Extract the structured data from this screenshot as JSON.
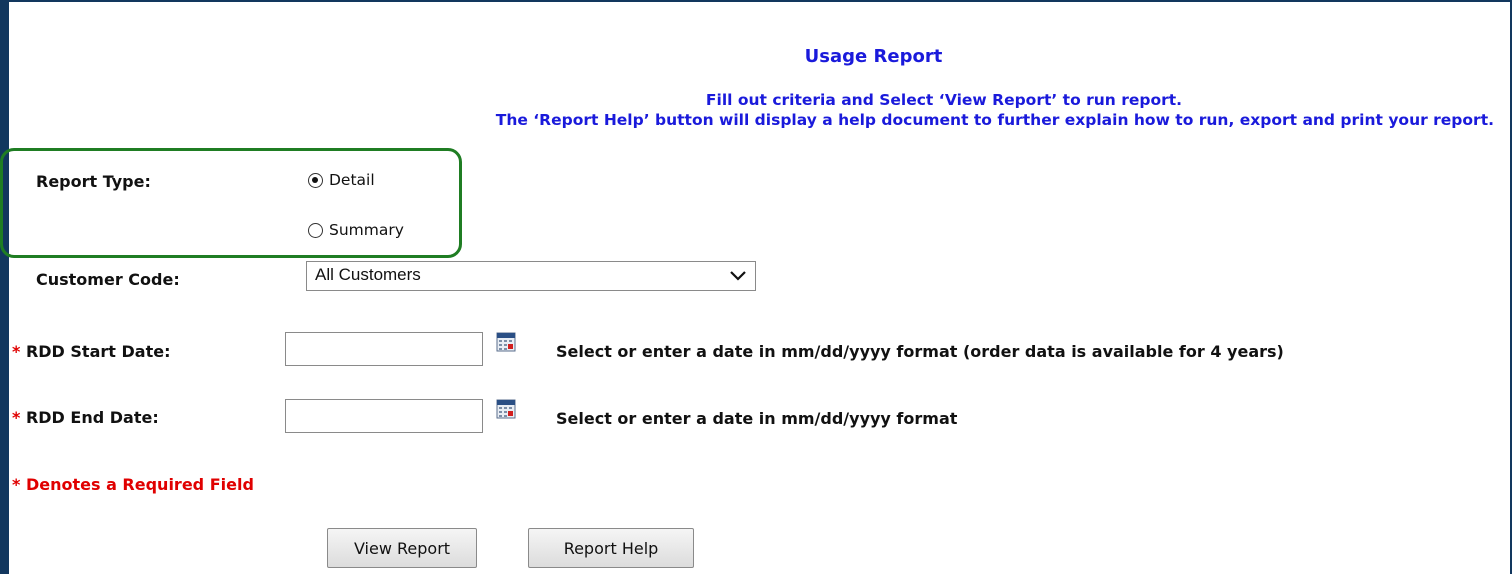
{
  "report": {
    "title": "Usage Report",
    "instruction_line1": "Fill out criteria and Select ‘View Report’ to run report.",
    "instruction_line2": "The ‘Report Help’ button will display a help document to further explain how to run, export and print your report."
  },
  "report_type": {
    "label": "Report Type:",
    "options": [
      {
        "label": "Detail",
        "checked": true
      },
      {
        "label": "Summary",
        "checked": false
      }
    ]
  },
  "customer_code": {
    "label": "Customer Code:",
    "selected": "All Customers"
  },
  "start_date": {
    "required_mark": "*",
    "label": "RDD Start Date:",
    "value": "",
    "hint": "Select or enter a date in mm/dd/yyyy format (order data is available for 4 years)"
  },
  "end_date": {
    "required_mark": "*",
    "label": "RDD End Date:",
    "value": "",
    "hint": "Select or enter a date in mm/dd/yyyy format"
  },
  "required_note": {
    "mark": "*",
    "text": "Denotes a Required Field"
  },
  "buttons": {
    "view_report": "View Report",
    "report_help": "Report Help"
  },
  "colors": {
    "heading": "#1a1adb",
    "required": "#e00000",
    "highlight": "#1f7d23",
    "frame": "#12375e"
  },
  "icons": [
    "calendar-icon",
    "chevron-down-icon"
  ]
}
